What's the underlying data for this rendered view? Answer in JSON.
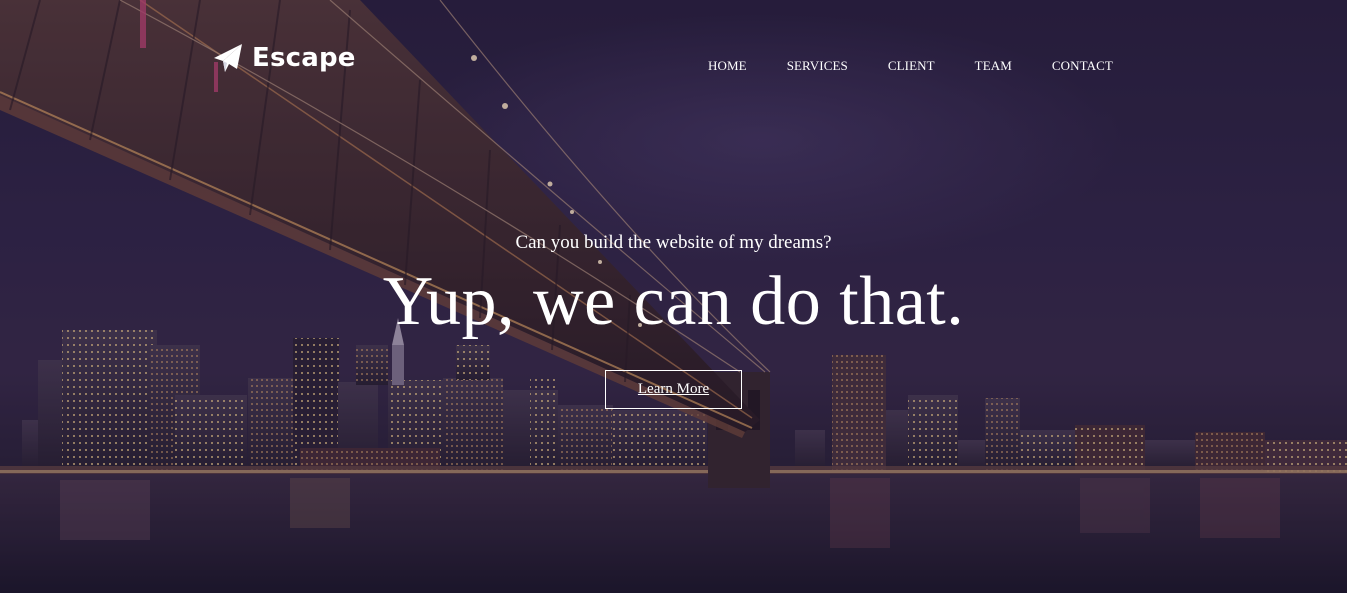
{
  "brand": {
    "name": "Escape",
    "icon": "paper-plane-icon"
  },
  "nav": {
    "items": [
      {
        "label": "HOME"
      },
      {
        "label": "SERVICES"
      },
      {
        "label": "CLIENT"
      },
      {
        "label": "TEAM"
      },
      {
        "label": "CONTACT"
      }
    ]
  },
  "hero": {
    "subtitle": "Can you build the website of my dreams?",
    "headline": "Yup, we can do that.",
    "cta_label": "Learn More",
    "background": "night-city-bridge-photo"
  },
  "colors": {
    "text": "#ffffff",
    "overlay": "#1c1230",
    "sky": "#2a2140",
    "water": "#1c1830",
    "city_lights": "#f3c27a"
  }
}
